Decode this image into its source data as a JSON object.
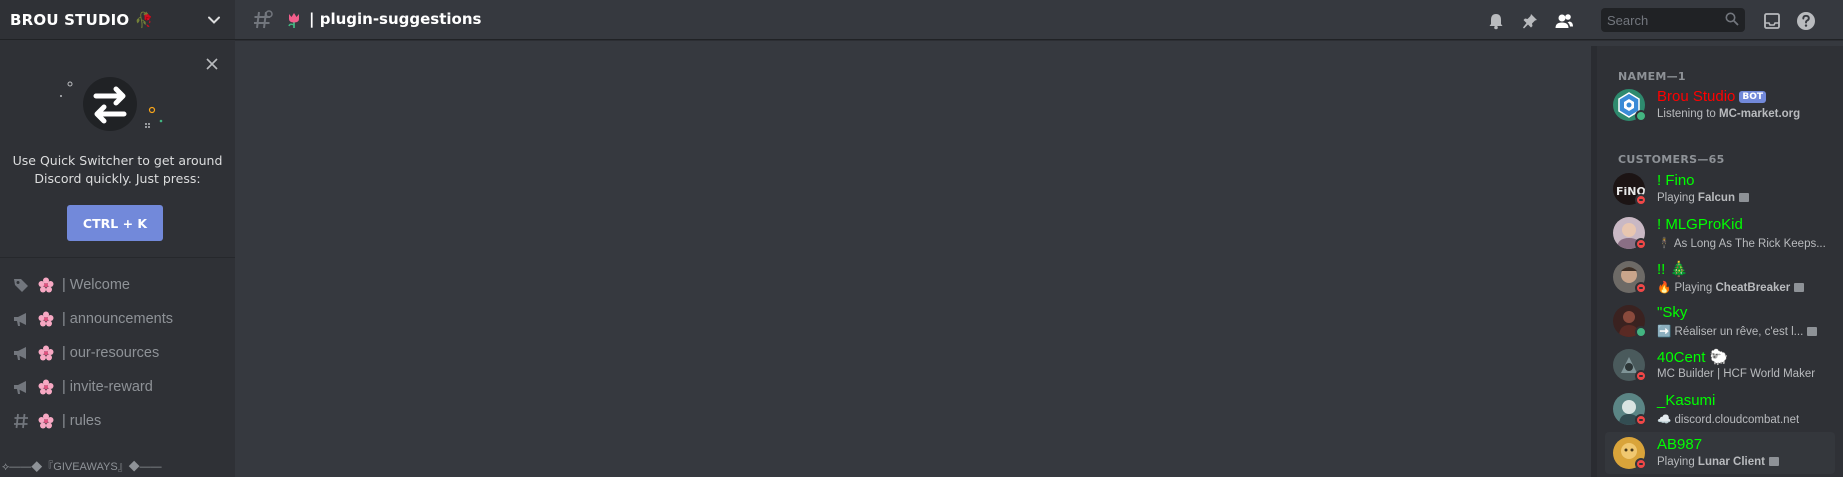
{
  "guild": {
    "name": "BROU STUDIO 🥀"
  },
  "quick_switcher": {
    "text_line1": "Use Quick Switcher to get around",
    "text_line2": "Discord quickly. Just press:",
    "shortcut": "CTRL + K"
  },
  "channels": [
    {
      "name": "| Welcome",
      "icon": "tag-icon"
    },
    {
      "name": "| announcements",
      "icon": "megaphone-icon"
    },
    {
      "name": "| our-resources",
      "icon": "megaphone-icon"
    },
    {
      "name": "| invite-reward",
      "icon": "megaphone-icon"
    },
    {
      "name": "| rules",
      "icon": "hash-icon"
    }
  ],
  "category_label": "⟡——◆『GIVEAWAYS』◆——",
  "header": {
    "channel_name": "| plugin-suggestions",
    "search_placeholder": "Search"
  },
  "members": {
    "groups": [
      {
        "label": "NAMEM—1"
      },
      {
        "label": "CUSTOMERS—65"
      }
    ],
    "bot": {
      "name": "Brou Studio",
      "tag": "BOT",
      "activity_prefix": "Listening to ",
      "activity_bold": "MC-market.org",
      "name_color": "#ff0000"
    },
    "list": [
      {
        "name": "! Fino",
        "activity_prefix": "Playing ",
        "activity_bold": "Falcun",
        "status": "dnd"
      },
      {
        "name": "! MLGProKid",
        "activity_prefix": "🕴 As Long As The Rick Keeps...",
        "activity_bold": "",
        "status": "dnd"
      },
      {
        "name": "!! 🎄",
        "activity_prefix": "🔥 Playing ",
        "activity_bold": "CheatBreaker",
        "status": "dnd"
      },
      {
        "name": "\"Sky",
        "activity_prefix": "➡️ Réaliser un rêve, c'est l...",
        "activity_bold": "",
        "status": "online"
      },
      {
        "name": "40Cent 🐑",
        "activity_prefix": "MC Builder | HCF World Maker",
        "activity_bold": "",
        "status": "dnd"
      },
      {
        "name": "_Kasumi",
        "activity_prefix": "☁️ discord.cloudcombat.net",
        "activity_bold": "",
        "status": "dnd"
      },
      {
        "name": "AB987",
        "activity_prefix": "Playing ",
        "activity_bold": "Lunar Client",
        "status": "dnd"
      }
    ],
    "customer_color": "#00ff00"
  },
  "colors": {
    "blurple": "#7289da",
    "online": "#43b581",
    "dnd": "#f04747"
  }
}
